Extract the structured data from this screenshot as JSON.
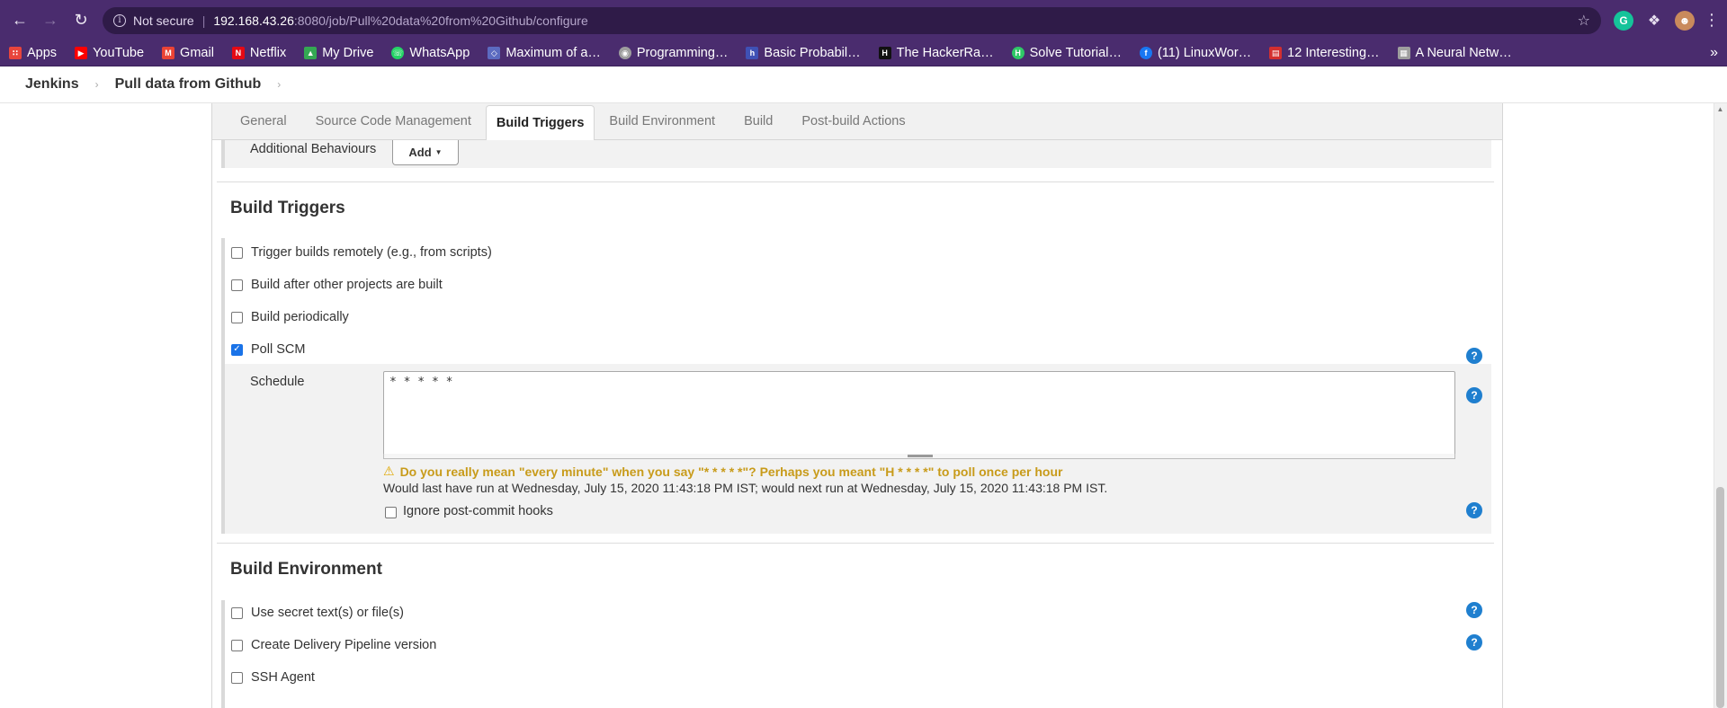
{
  "browser": {
    "not_secure": "Not secure",
    "url_host": "192.168.43.26",
    "url_path": ":8080/job/Pull%20data%20from%20Github/configure",
    "bookmarks": [
      {
        "label": "Apps",
        "color": "#e8453c"
      },
      {
        "label": "YouTube",
        "color": "#ff0000"
      },
      {
        "label": "Gmail",
        "color": "#ea4335"
      },
      {
        "label": "Netflix",
        "color": "#e50914"
      },
      {
        "label": "My Drive",
        "color": "#34a853"
      },
      {
        "label": "WhatsApp",
        "color": "#25d366"
      },
      {
        "label": "Maximum of a…",
        "color": "#5c6bc0"
      },
      {
        "label": "Programming…",
        "color": "#9e9e9e"
      },
      {
        "label": "Basic Probabil…",
        "color": "#3f51b5"
      },
      {
        "label": "The HackerRa…",
        "color": "#111111"
      },
      {
        "label": "Solve Tutorial…",
        "color": "#2ec866"
      },
      {
        "label": "(11) LinuxWor…",
        "color": "#1877f2"
      },
      {
        "label": "12 Interesting…",
        "color": "#d32f2f"
      },
      {
        "label": "A Neural Netw…",
        "color": "#9e9e9e"
      }
    ]
  },
  "breadcrumb": {
    "root": "Jenkins",
    "job": "Pull data from Github"
  },
  "tabs": [
    "General",
    "Source Code Management",
    "Build Triggers",
    "Build Environment",
    "Build",
    "Post-build Actions"
  ],
  "active_tab": "Build Triggers",
  "additional_behaviours": {
    "label": "Additional Behaviours",
    "add_button": "Add"
  },
  "build_triggers": {
    "title": "Build Triggers",
    "options": [
      {
        "label": "Trigger builds remotely (e.g., from scripts)",
        "checked": false
      },
      {
        "label": "Build after other projects are built",
        "checked": false
      },
      {
        "label": "Build periodically",
        "checked": false
      },
      {
        "label": "Poll SCM",
        "checked": true
      }
    ],
    "schedule_label": "Schedule",
    "schedule_value": "* * * * *",
    "warning": "Do you really mean \"every minute\" when you say \"* * * * *\"? Perhaps you meant \"H * * * *\" to poll once per hour",
    "run_info": "Would last have run at Wednesday, July 15, 2020 11:43:18 PM IST; would next run at Wednesday, July 15, 2020 11:43:18 PM IST.",
    "ignore_hooks": "Ignore post-commit hooks"
  },
  "build_environment": {
    "title": "Build Environment",
    "options": [
      {
        "label": "Use secret text(s) or file(s)",
        "checked": false
      },
      {
        "label": "Create Delivery Pipeline version",
        "checked": false
      },
      {
        "label": "SSH Agent",
        "checked": false
      }
    ]
  },
  "colors": {
    "chrome": "#4a2c6e",
    "help": "#1f7fcf",
    "warning": "#c89b1a"
  }
}
